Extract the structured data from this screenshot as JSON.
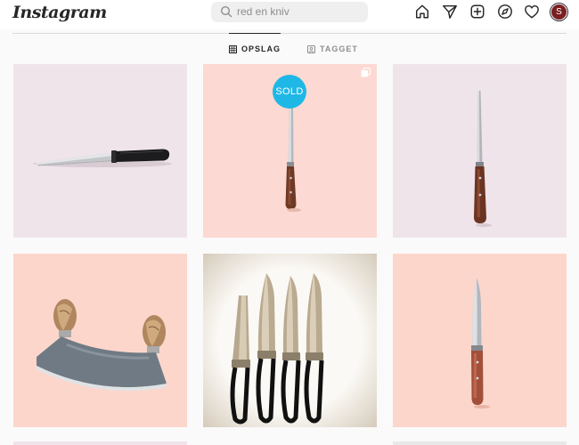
{
  "header": {
    "logo": "Instagram",
    "search": {
      "value": "red en kniv",
      "icon": "search-icon"
    },
    "nav_icons": [
      "home-icon",
      "direct-message-icon",
      "new-post-icon",
      "explore-icon",
      "activity-heart-icon"
    ],
    "avatar_initial": "S"
  },
  "tabs": [
    {
      "label": "OPSLAG",
      "icon": "grid-icon",
      "active": true
    },
    {
      "label": "TAGGET",
      "icon": "tagged-icon",
      "active": false
    }
  ],
  "posts": [
    {
      "subject": "bread knife with black handle",
      "background": "#efe4ea"
    },
    {
      "subject": "slim knife with wooden handle",
      "background": "#fcd9d2",
      "badge": "SOLD",
      "multi_image": true
    },
    {
      "subject": "fillet knife with wooden handle",
      "background": "#efe4ea"
    },
    {
      "subject": "mezzaluna rocking knife with olive wood handles",
      "background": "#fcd6cb"
    },
    {
      "subject": "set of four knives with black loop handles",
      "background": "#f3efe8"
    },
    {
      "subject": "paring knife with wooden handle",
      "background": "#fcd6cb"
    }
  ],
  "colors": {
    "sold_badge": "#1fb8e6",
    "avatar": "#7a1f22",
    "text": "#262626",
    "muted": "#8e8e8e"
  }
}
